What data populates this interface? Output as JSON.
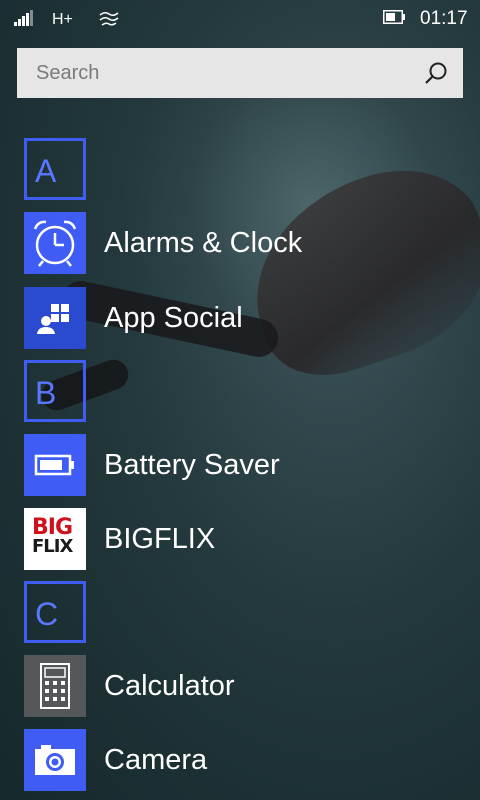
{
  "status_bar": {
    "network_type": "H+",
    "time": "01:17",
    "icons": [
      "signal-bars-icon",
      "wifi-calling-icon",
      "battery-icon"
    ]
  },
  "search": {
    "placeholder": "Search",
    "icon": "search-icon"
  },
  "accent_color": "#3f5df5",
  "app_list": [
    {
      "kind": "letter",
      "label": "A"
    },
    {
      "kind": "app",
      "label": "Alarms & Clock",
      "icon": "alarm-clock-icon"
    },
    {
      "kind": "app",
      "label": "App Social",
      "icon": "app-social-icon"
    },
    {
      "kind": "letter",
      "label": "B"
    },
    {
      "kind": "app",
      "label": "Battery Saver",
      "icon": "battery-saver-icon"
    },
    {
      "kind": "app",
      "label": "BIGFLIX",
      "icon": "bigflix-logo",
      "logo_text": [
        "BIG",
        "FLIX"
      ]
    },
    {
      "kind": "letter",
      "label": "C"
    },
    {
      "kind": "app",
      "label": "Calculator",
      "icon": "calculator-icon"
    },
    {
      "kind": "app",
      "label": "Camera",
      "icon": "camera-icon"
    }
  ]
}
